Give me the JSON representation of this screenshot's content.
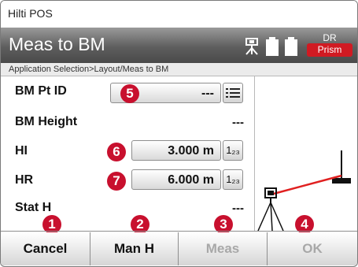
{
  "app": {
    "title": "Hilti POS"
  },
  "header": {
    "title": "Meas to BM",
    "mode_top": "DR",
    "mode_badge": "Prism",
    "tripod_icon": "tripod-icon",
    "battery_icon": "battery-icon"
  },
  "breadcrumb": "Application Selection>Layout/Meas to BM",
  "fields": {
    "bm_pt_id": {
      "label": "BM Pt ID",
      "value": "---",
      "button_icon": "list-icon"
    },
    "bm_height": {
      "label": "BM Height",
      "value": "---"
    },
    "hi": {
      "label": "HI",
      "value": "3.000 m",
      "button_text": "1₂₃"
    },
    "hr": {
      "label": "HR",
      "value": "6.000 m",
      "button_text": "1₂₃"
    },
    "stat_h": {
      "label": "Stat H",
      "value": "---"
    }
  },
  "callouts": [
    "1",
    "2",
    "3",
    "4",
    "5",
    "6",
    "7"
  ],
  "softkeys": [
    {
      "label": "Cancel",
      "enabled": true
    },
    {
      "label": "Man H",
      "enabled": true
    },
    {
      "label": "Meas",
      "enabled": false
    },
    {
      "label": "OK",
      "enabled": false
    }
  ],
  "colors": {
    "accent_red": "#c8102e",
    "badge_red": "#d11a22",
    "header_gray": "#5e5e5e",
    "laser_red": "#e02020"
  }
}
